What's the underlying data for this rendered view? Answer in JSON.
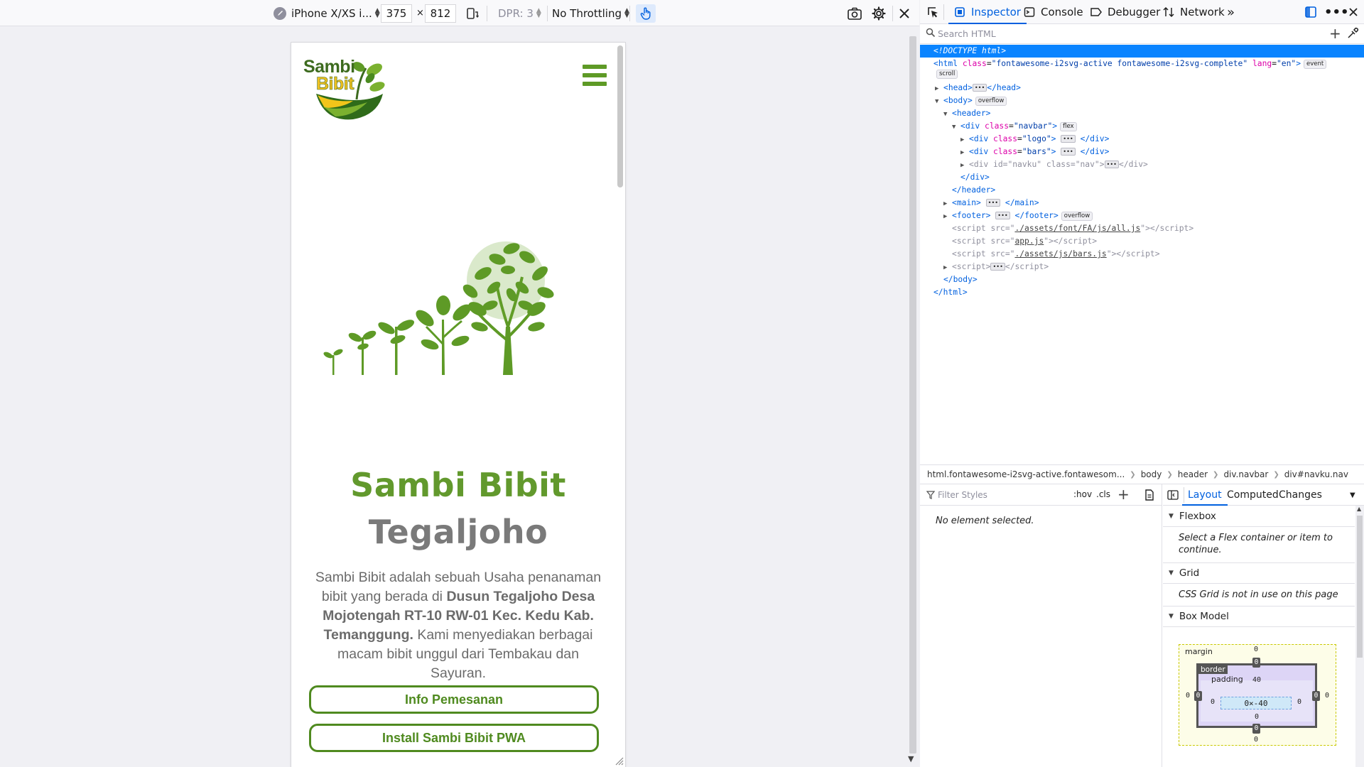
{
  "toolbar": {
    "device": "iPhone X/XS i...",
    "width": "375",
    "times": "×",
    "height": "812",
    "dpr": "DPR: 3",
    "throttling": "No Throttling"
  },
  "site": {
    "logo_line1": "Sambi",
    "logo_line2": "Bibit",
    "title_line1": "Sambi Bibit",
    "title_line2": "Tegaljoho",
    "desc_part1": "Sambi Bibit adalah sebuah Usaha penanaman bibit yang berada di ",
    "desc_bold": "Dusun Tegaljoho Desa Mojotengah RT-10 RW-01 Kec. Kedu Kab. Temanggung.",
    "desc_part2": " Kami menyediakan berbagai macam bibit unggul dari Tembakau dan Sayuran.",
    "button1": "Info Pemesanan",
    "button2": "Install Sambi Bibit PWA"
  },
  "devtools": {
    "tabs": [
      "Inspector",
      "Console",
      "Debugger",
      "Network"
    ],
    "search_placeholder": "Search HTML",
    "markup": {
      "doctype": "<!DOCTYPE html>",
      "html_tag": "html",
      "html_class_attr": "class",
      "html_class_val": "\"fontawesome-i2svg-active fontawesome-i2svg-complete\"",
      "html_lang_attr": "lang",
      "html_lang_val": "\"en\"",
      "badge_event": "event",
      "badge_scroll": "scroll",
      "badge_overflow": "overflow",
      "badge_flex": "flex",
      "head": "head",
      "body": "body",
      "header": "header",
      "div": "div",
      "class_attr": "class",
      "id_attr": "id",
      "navbar_val": "\"navbar\"",
      "logo_val": "\"logo\"",
      "bars_val": "\"bars\"",
      "navku_id": "\"navku\"",
      "nav_val": "\"nav\"",
      "main": "main",
      "footer": "footer",
      "script": "script",
      "src_attr": "src",
      "src1": "./assets/font/FA/js/all.js",
      "src2": "app.js",
      "src3": "./assets/js/bars.js"
    },
    "breadcrumbs": [
      "html.fontawesome-i2svg-active.fontawesom...",
      "body",
      "header",
      "div.navbar",
      "div#navku.nav"
    ],
    "rules_filter": "Filter Styles",
    "hov": ":hov",
    "cls": ".cls",
    "no_element": "No element selected.",
    "side_tabs": [
      "Layout",
      "Computed",
      "Changes"
    ],
    "flexbox_title": "Flexbox",
    "flexbox_msg": "Select a Flex container or item to continue.",
    "grid_title": "Grid",
    "grid_msg": "CSS Grid is not in use on this page",
    "boxmodel_title": "Box Model",
    "boxmodel": {
      "margin_label": "margin",
      "border_label": "border",
      "padding_label": "padding",
      "margin_top": "0",
      "margin_bottom": "0",
      "margin_left": "0",
      "margin_right": "0",
      "border_top": "0",
      "border_bottom": "0",
      "border_left": "0",
      "border_right": "0",
      "padding_top": "40",
      "padding_bottom": "0",
      "padding_left": "0",
      "padding_right": "0",
      "content": "0×-40"
    }
  },
  "colors": {
    "brand_green": "#62992d",
    "accent_blue": "#0060df"
  }
}
